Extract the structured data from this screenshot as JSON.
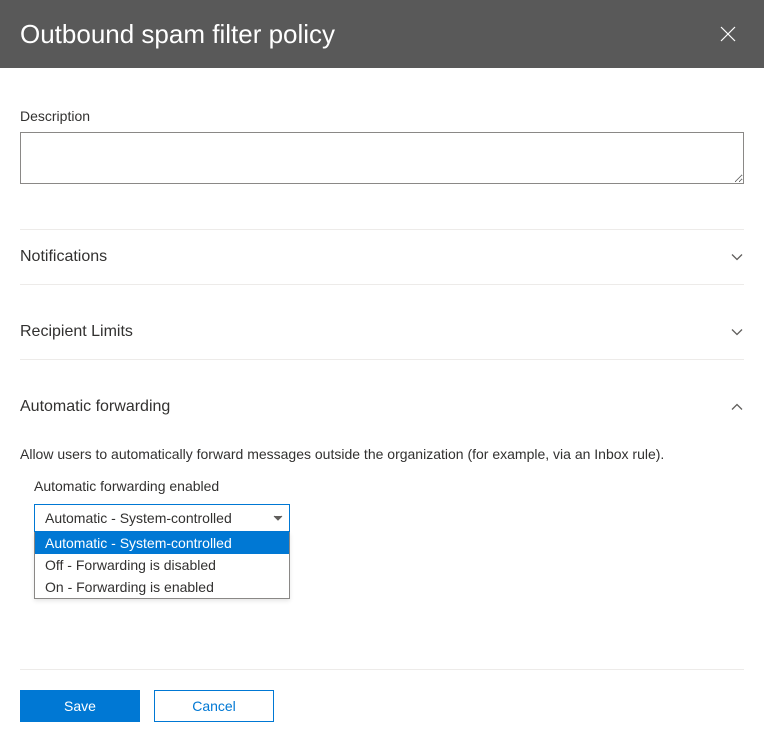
{
  "header": {
    "title": "Outbound spam filter policy"
  },
  "description": {
    "label": "Description",
    "value": ""
  },
  "sections": {
    "notifications": {
      "title": "Notifications"
    },
    "recipientLimits": {
      "title": "Recipient Limits"
    },
    "automaticForwarding": {
      "title": "Automatic forwarding",
      "desc": "Allow users to automatically forward messages outside the organization (for example, via an Inbox rule).",
      "fieldLabel": "Automatic forwarding enabled",
      "selected": "Automatic - System-controlled",
      "options": [
        "Automatic - System-controlled",
        "Off - Forwarding is disabled",
        "On - Forwarding is enabled"
      ]
    }
  },
  "footer": {
    "save": "Save",
    "cancel": "Cancel"
  }
}
